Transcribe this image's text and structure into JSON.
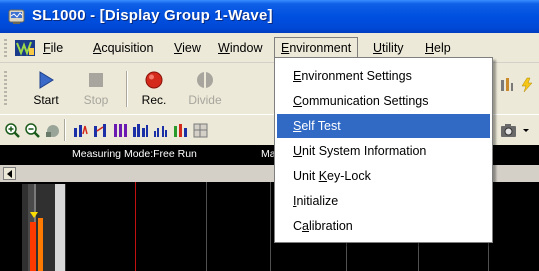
{
  "window": {
    "title": "SL1000 - [Display Group 1-Wave]"
  },
  "menubar": {
    "items": [
      {
        "label": "File",
        "underline": "F",
        "rest": "ile"
      },
      {
        "label": "Acquisition",
        "underline": "A",
        "rest": "cquisition"
      },
      {
        "label": "View",
        "underline": "V",
        "rest": "iew"
      },
      {
        "label": "Window",
        "underline": "W",
        "rest": "indow"
      },
      {
        "label": "Environment",
        "underline": "E",
        "rest": "nvironment"
      },
      {
        "label": "Utility",
        "underline": "U",
        "rest": "tility"
      },
      {
        "label": "Help",
        "underline": "H",
        "rest": "elp"
      }
    ],
    "open_menu": "Environment"
  },
  "toolbar": {
    "buttons": [
      {
        "label": "Start",
        "icon": "play-icon",
        "enabled": true
      },
      {
        "label": "Stop",
        "icon": "stop-icon",
        "enabled": false
      },
      {
        "label": "Rec.",
        "icon": "record-icon",
        "enabled": true
      },
      {
        "label": "Divide",
        "icon": "divide-icon",
        "enabled": false
      }
    ]
  },
  "status": {
    "measuring_mode": "Measuring Mode:Free Run",
    "partial": "Ma"
  },
  "environment_menu": {
    "items": [
      {
        "pre": "",
        "ul": "E",
        "post": "nvironment Settings",
        "selected": false
      },
      {
        "pre": "",
        "ul": "C",
        "post": "ommunication Settings",
        "selected": false
      },
      {
        "pre": "",
        "ul": "S",
        "post": "elf Test",
        "selected": true
      },
      {
        "pre": "",
        "ul": "U",
        "post": "nit System Information",
        "selected": false
      },
      {
        "pre": "Unit ",
        "ul": "K",
        "post": "ey-Lock",
        "selected": false
      },
      {
        "pre": "",
        "ul": "I",
        "post": "nitialize",
        "selected": false
      },
      {
        "pre": "C",
        "ul": "a",
        "post": "libration",
        "selected": false
      }
    ]
  },
  "colors": {
    "titlebar": "#0050e0",
    "chrome": "#ece9d8",
    "selection": "#316ac5",
    "record_red": "#d42a1c",
    "trace_red": "#ff2a00"
  }
}
